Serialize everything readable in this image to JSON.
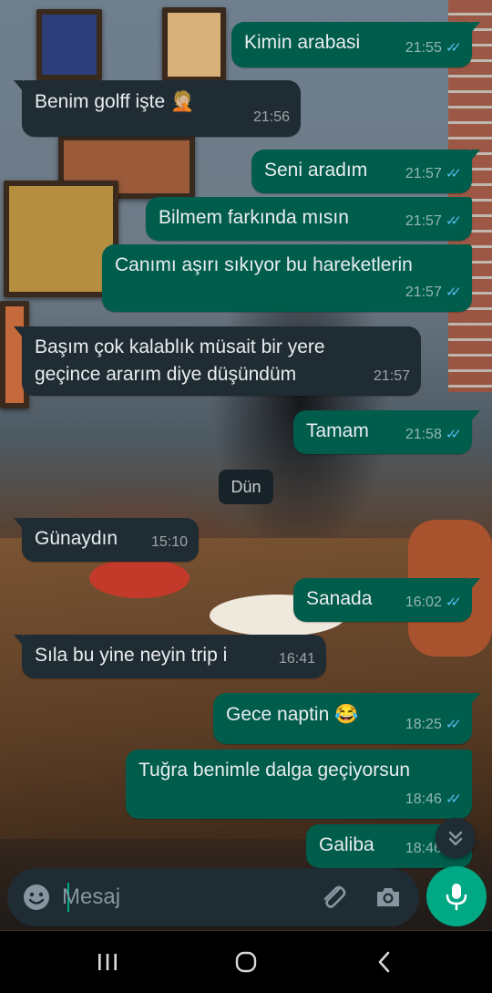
{
  "chat": {
    "messages": [
      {
        "dir": "out",
        "text": "Kimin arabasi",
        "time": "21:55",
        "read": true
      },
      {
        "dir": "in",
        "text": "Benim golff işte 🤦🏼",
        "time": "21:56"
      },
      {
        "dir": "out",
        "text": "Seni aradım",
        "time": "21:57",
        "read": true
      },
      {
        "dir": "out",
        "text": "Bilmem farkında mısın",
        "time": "21:57",
        "read": true
      },
      {
        "dir": "out",
        "text": "Canımı aşırı sıkıyor bu hareketlerin",
        "time": "21:57",
        "read": true
      },
      {
        "dir": "in",
        "text": "Başım çok kalablık müsait bir yere\ngeçince ararım diye düşündüm",
        "time": "21:57"
      },
      {
        "dir": "out",
        "text": "Tamam",
        "time": "21:58",
        "read": true
      },
      {
        "dir": "in",
        "text": "Günaydın",
        "time": "15:10"
      },
      {
        "dir": "out",
        "text": "Sanada",
        "time": "16:02",
        "read": true
      },
      {
        "dir": "in",
        "text": "Sıla bu yine neyin trip i",
        "time": "16:41"
      },
      {
        "dir": "out",
        "text": "Gece naptin 😂",
        "time": "18:25",
        "read": true
      },
      {
        "dir": "out",
        "text": "Tuğra benimle dalga geçiyorsun",
        "time": "18:46",
        "read": true
      },
      {
        "dir": "out",
        "text": "Galiba",
        "time": "18:46",
        "read": true
      }
    ],
    "date_separator": "Dün"
  },
  "composer": {
    "placeholder": "Mesaj"
  },
  "icons": {
    "emoji": "emoji-icon",
    "attach": "paperclip-icon",
    "camera": "camera-icon",
    "mic": "microphone-icon",
    "scroll_down": "double-chevron-down-icon",
    "read_receipt": "double-check-icon"
  },
  "navbar": {
    "recent": "recent-apps-icon",
    "home": "home-icon",
    "back": "back-icon"
  },
  "colors": {
    "outgoing_bubble": "#005c4b",
    "incoming_bubble": "#202c33",
    "accent": "#00a884",
    "read_ticks": "#53bdeb"
  }
}
